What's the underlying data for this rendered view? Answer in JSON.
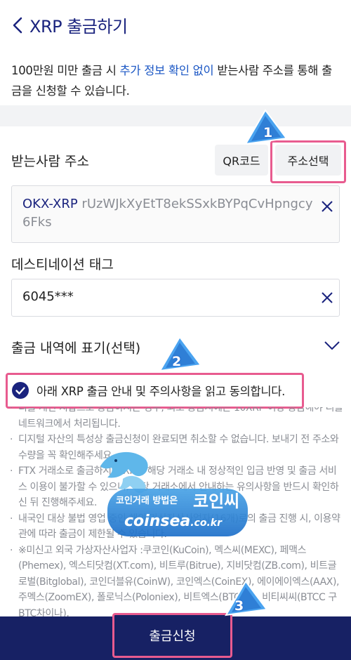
{
  "header": {
    "title": "XRP 출금하기"
  },
  "notice": {
    "part1": "100만원 미만 출금 시 ",
    "highlight": "추가 정보 확인 없이",
    "part2": " 받는사람 주소를 통해 출금을 신청할 수 있습니다."
  },
  "address": {
    "label": "받는사람 주소",
    "qr_button": "QR코드",
    "select_button": "주소선택",
    "tag": "OKX-XRP",
    "value": " rUzWJkXyEtT8ekSSxkBYPqCvHpngcy6Fks"
  },
  "destination_tag": {
    "label": "데스티네이션 태그",
    "value": "6045***"
  },
  "history": {
    "label": "출금 내역에 표기(선택)"
  },
  "agreement": {
    "text": "아래 XRP 출금 안내 및 주의사항을 읽고 동의합니다."
  },
  "notes": [
    "리플 개인 지갑으로 송금하시는 경우, 최초 송금시에는 10XRP 이상 송금해야 리플 네트워크에서 처리됩니다.",
    "디지털 자산의 특성상 출금신청이 완료되면 취소할 수 없습니다. 보내기 전 주소와 수량을 꼭 확인해주세요.",
    "FTX 거래소로 출금하시는 XRP, 해당 거래소 내 정상적인 입금 반영 및 출금 서비스 이용이 불가할 수 있으니, 해당 거래소에서 안내하는 유의사항을 반드시 확인하신 뒤 진행해주세요.",
    "내국인 대상 불법 영업 중인 해외 가상자산사업자(16개)로의 출금 진행 시, 이용약관에 따라 출금이 제한될 수 있습니다.",
    "※미신고 외국 가상자산사업자 :쿠코인(KuCoin), 멕스씨(MEXC), 페맥스(Phemex), 엑스티닷컴(XT.com), 비트루(Bitrue), 지비닷컴(ZB.com), 비트글로벌(Bitglobal), 코인더블유(CoinW), 코인엑스(CoinEX), 에이에이엑스(AAX), 주멕스(ZoomEX), 폴로닉스(Poloniex), 비트엑스(BTCEX), 비티씨씨(BTCC 구 BTC차이나),"
  ],
  "submit": {
    "label": "출금신청"
  },
  "steps": [
    "1",
    "2",
    "3"
  ],
  "watermark": {
    "line1": "코인거래 방법은",
    "brand": "코인씨",
    "domain_main": "coinsea",
    "domain_tld": ".co.kr"
  },
  "colors": {
    "navy": "#172164",
    "highlight_blue": "#1a56c4",
    "annotation_pink": "#e85b8f"
  }
}
